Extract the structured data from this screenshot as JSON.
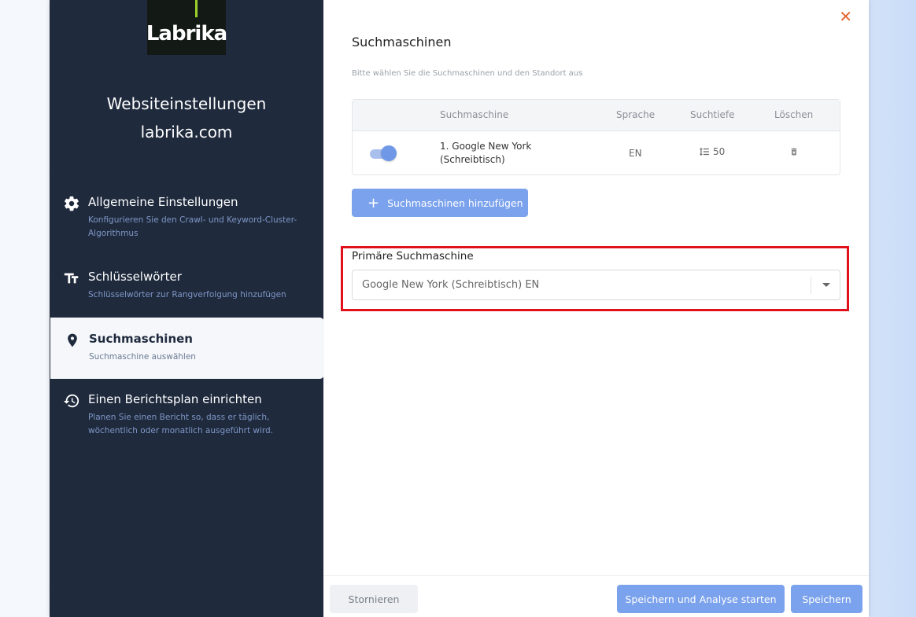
{
  "logo": {
    "text": "Labrika"
  },
  "sidebar": {
    "title": "Websiteinstellungen",
    "domain": "labrika.com",
    "items": [
      {
        "icon": "gear-icon",
        "title": "Allgemeine Einstellungen",
        "desc": "Konfigurieren Sie den Crawl- und Keyword-Cluster-Algorithmus"
      },
      {
        "icon": "text-size-icon",
        "title": "Schlüsselwörter",
        "desc": "Schlüsselwörter zur Rangverfolgung hinzufügen"
      },
      {
        "icon": "map-pin-icon",
        "title": "Suchmaschinen",
        "desc": "Suchmaschine auswählen",
        "active": true
      },
      {
        "icon": "history-clock-icon",
        "title": "Einen Berichtsplan einrichten",
        "desc": "Planen Sie einen Bericht so, dass er täglich, wöchentlich oder monatlich ausgeführt wird."
      }
    ]
  },
  "main": {
    "title": "Suchmaschinen",
    "subtitle": "Bitte wählen Sie die Suchmaschinen und den Standort aus",
    "table": {
      "headers": {
        "engine": "Suchmaschine",
        "language": "Sprache",
        "depth": "Suchtiefe",
        "delete": "Löschen"
      },
      "rows": [
        {
          "enabled": true,
          "engine_line1": "1. Google New York",
          "engine_line2": "(Schreibtisch)",
          "language": "EN",
          "depth": "50"
        }
      ]
    },
    "add_button": "Suchmaschinen hinzufügen",
    "primary": {
      "label": "Primäre Suchmaschine",
      "value": "Google New York (Schreibtisch) EN"
    }
  },
  "footer": {
    "cancel": "Stornieren",
    "save_analyze": "Speichern und Analyse starten",
    "save": "Speichern"
  },
  "colors": {
    "accent": "#7ba2ec",
    "sidebar": "#1f2a3d",
    "highlight": "#e0111b",
    "close": "#e4672f"
  }
}
